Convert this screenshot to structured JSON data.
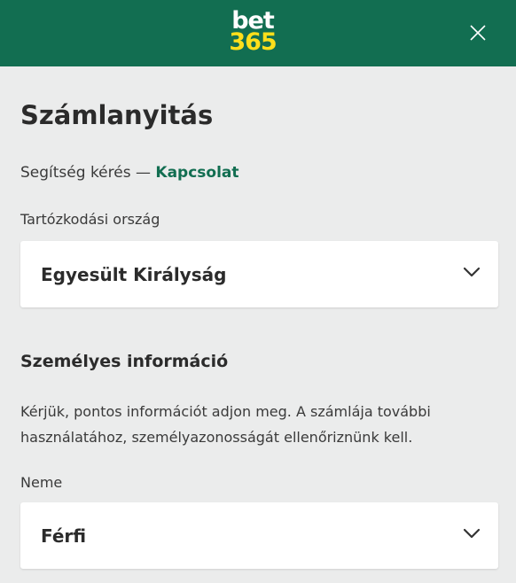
{
  "header": {
    "logo_top": "bet",
    "logo_bottom": "365",
    "close_icon": "close-icon",
    "background_color": "#126e51",
    "logo_accent_color": "#ffdf1b"
  },
  "page": {
    "title": "Számlanyitás",
    "help_text": "Segítség kérés — ",
    "help_link": "Kapcsolat"
  },
  "country": {
    "label": "Tartózkodási ország",
    "value": "Egyesült Királyság",
    "icon": "chevron-down-icon"
  },
  "personal": {
    "title": "Személyes információ",
    "description": "Kérjük, pontos információt adjon meg. A számlája további használatához, személyazonosságát ellenőriznünk kell."
  },
  "gender": {
    "label": "Neme",
    "value": "Férfi",
    "icon": "chevron-down-icon"
  }
}
